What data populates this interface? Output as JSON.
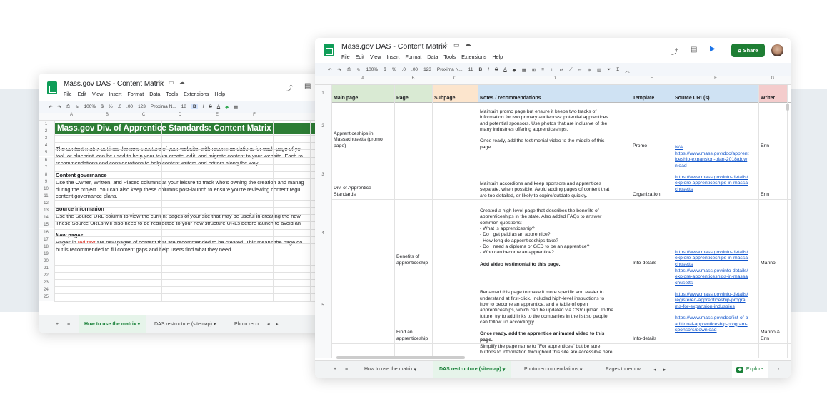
{
  "back": {
    "title": "Mass.gov DAS - Content Matrix",
    "menus": [
      "File",
      "Edit",
      "View",
      "Insert",
      "Format",
      "Data",
      "Tools",
      "Extensions",
      "Help"
    ],
    "toolbar": {
      "zoom": "100%",
      "font": "Proxima N...",
      "size": "18"
    },
    "columns": [
      "A",
      "B",
      "C",
      "D",
      "E",
      "F"
    ],
    "rows": [
      "1",
      "2",
      "3",
      "4",
      "5",
      "6",
      "7",
      "8",
      "9",
      "10",
      "11",
      "12",
      "13",
      "14",
      "15",
      "16",
      "17",
      "18",
      "19",
      "20",
      "21",
      "22",
      "23",
      "24",
      "25"
    ],
    "heading": "Mass.gov Div. of Apprentice Standards: Content Matrix",
    "intro": [
      "The content matrix outlines the new structure of your website, with recommendations for each page of yo",
      "tool, or blueprint, can be used to help your team create, edit, and migrate content to your website. Each ro",
      "recommendations and considerations to help content writers and editors along the way."
    ],
    "gov_title": "Content governance",
    "gov": [
      "Use the Owner, Written, and Placed columns at your leisure to track who's owning the creation and manag",
      "during the project. You can also keep these columns post-launch to ensure you're reviewing content regu",
      "content governance plans."
    ],
    "src_title": "Source information",
    "src": [
      "Use the Source URL column to view the current pages of your site that may be useful in creating the new",
      "These Source URLs will also need to be redirected to your new structure URLs before launch to avoid an"
    ],
    "new_title": "New pages",
    "new_pre": "Pages in ",
    "new_red": "red text",
    "new_post": " are new pages of content that are recommended to be created. This means the page do",
    "new2": "but is recommended to fill content gaps and help users find what they need.",
    "tabs": [
      "How to use the matrix",
      "DAS restructure (sitemap)",
      "Photo reco"
    ]
  },
  "front": {
    "title": "Mass.gov DAS - Content Matrix",
    "menus": [
      "File",
      "Edit",
      "View",
      "Insert",
      "Format",
      "Data",
      "Tools",
      "Extensions",
      "Help"
    ],
    "share": "Share",
    "toolbar": {
      "zoom": "100%",
      "font": "Proxima N...",
      "size": "11",
      "fmt": "123"
    },
    "columns": [
      "A",
      "B",
      "C",
      "D",
      "E",
      "F",
      "G"
    ],
    "headers": [
      "Main page",
      "Page",
      "Subpage",
      "Notes / recommendations",
      "Template",
      "Source URL(s)",
      "Writer"
    ],
    "header_colors": [
      "#d9ead3",
      "#d9ead3",
      "#fce5cd",
      "#cfe2f3",
      "#cfe2f3",
      "#cfe2f3",
      "#f4cccc"
    ],
    "rows": [
      {
        "num": "2",
        "main": "Apprenticeships in Massachusetts (promo page)",
        "page": "",
        "sub": "",
        "notes": [
          "Maintain promo page but ensure it keeps two tracks of",
          "information for two primary audiences: potential apprentices",
          "and potential sponsors. Use photos that are inclusive of the",
          "many industries offering apprenticeships.",
          "",
          "Once ready, add the testimonial video to the middle of this",
          "page"
        ],
        "template": "Promo",
        "urls": [
          "N/A"
        ],
        "writer": "Erin"
      },
      {
        "num": "3",
        "main": "Div. of Apprentice Standards",
        "page": "",
        "sub": "",
        "notes": [
          "Maintain accordions and keep sponsors and apprentices",
          "separate, when possible. Avoid adding pages of content that",
          "are too detailed, or likely to expire/outdate quickly."
        ],
        "template": "Organization",
        "urls": [
          "https://www.mass.gov/doc/apprent",
          "iceship-expansion-plan-2018/dow",
          "nload",
          "",
          "https://www.mass.gov/info-details/",
          "explore-apprenticeships-in-massa",
          "chusetts"
        ],
        "writer": "Erin"
      },
      {
        "num": "4",
        "main": "",
        "page": "Benefits of apprenticeship",
        "sub": "",
        "notes": [
          "Created a high-level page that describes the benefits of",
          "apprenticeships in the state.  Also added FAQs to answer",
          "common questions:",
          "- What is apprenticeship?",
          "- Do I get paid as an apprentice?",
          "- How long do appernticeships take?",
          "- Do I need a diploma or GED to be an apprentice?",
          "- Who can become an apprentice?",
          "",
          "Add video testimonial to this page."
        ],
        "template": "Info-details",
        "urls": [
          "https://www.mass.gov/info-details/",
          "explore-apprenticeships-in-massa",
          "chusetts"
        ],
        "writer": "Marino"
      },
      {
        "num": "5",
        "main": "",
        "page": "Find an apprenticeship",
        "sub": "",
        "notes": [
          "",
          "Renamed this page to make it more specific and easier to",
          "understand at first-click. Included high-level instructions to",
          "how to become an apprentice, and a table of open",
          "apprenticeships, which can be updated via CSV upload. In the",
          "future, try to add links to the companies in the list so people",
          "can follow up accordingly.",
          "",
          "Once ready,  add the apprentice animated video to this",
          "page."
        ],
        "template": "Info-details",
        "urls": [
          "https://www.mass.gov/info-details/",
          "explore-apprenticeships-in-massa",
          "chusetts",
          "",
          "https://www.mass.gov/info-details/",
          "registered-apprenticeship-progra",
          "ms-for-expansion-industries",
          "",
          "https://www.mass.gov/doc/list-of-tr",
          "aditional-apprenticeship-program-",
          "sponsors/download"
        ],
        "writer": "Marino & Erin"
      },
      {
        "num": "",
        "main": "",
        "page": "",
        "sub": "",
        "notes": [
          "Simplify the page name to \"For apprentices\" but be sure",
          "buttons to information throughout this site are accessible here"
        ],
        "template": "",
        "urls": [],
        "writer": ""
      }
    ],
    "tabs": [
      "How to use the matrix",
      "DAS restructure (sitemap)",
      "Photo recommendations",
      "Pages to remov"
    ],
    "explore": "Explore"
  }
}
